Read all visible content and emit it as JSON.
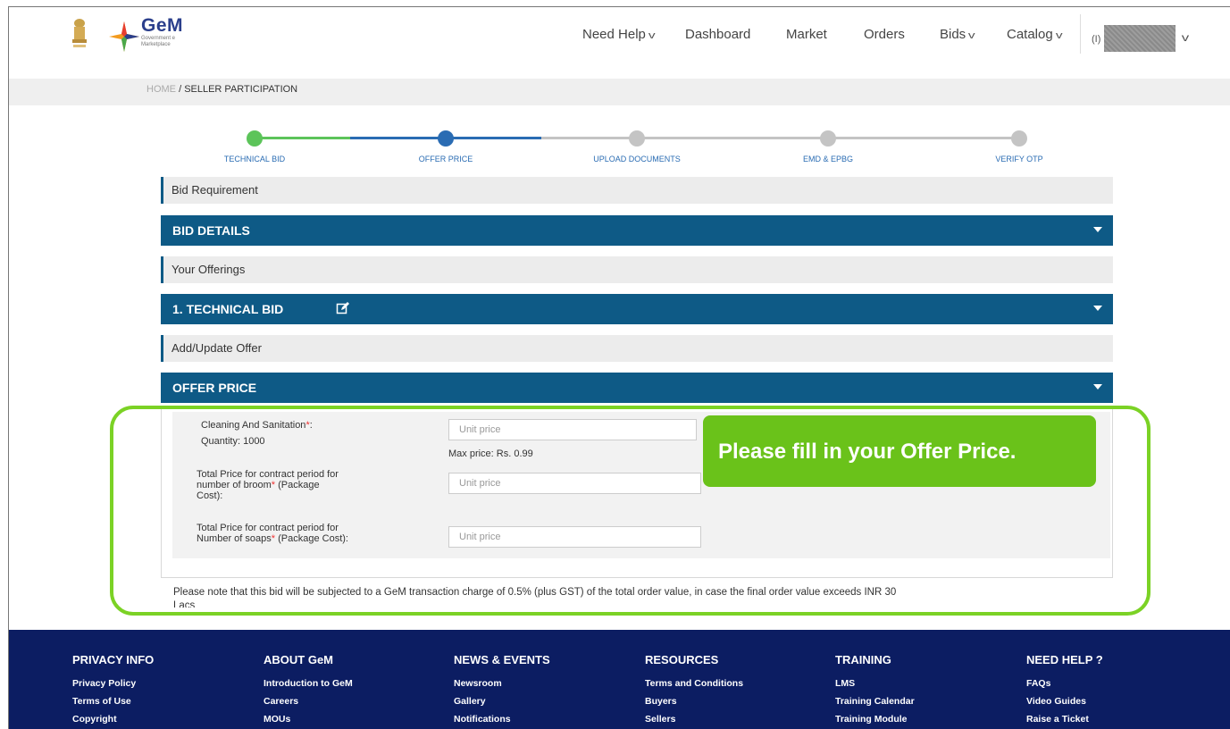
{
  "header": {
    "brand_name": "GeM",
    "brand_sub": "Government e Marketplace",
    "nav": [
      {
        "label": "Need Help",
        "dropdown": true
      },
      {
        "label": "Dashboard",
        "dropdown": false
      },
      {
        "label": "Market",
        "dropdown": false
      },
      {
        "label": "Orders",
        "dropdown": false
      },
      {
        "label": "Bids",
        "dropdown": true
      },
      {
        "label": "Catalog",
        "dropdown": true
      }
    ],
    "user_initial": "(I)"
  },
  "breadcrumb": {
    "home": "HOME",
    "separator": "/",
    "current": "SELLER PARTICIPATION"
  },
  "stepper": {
    "steps": [
      "TECHNICAL BID",
      "OFFER PRICE",
      "UPLOAD DOCUMENTS",
      "EMD & EPBG",
      "VERIFY OTP"
    ],
    "completed_color": "#5cc45a",
    "active_color": "#2a6cb3",
    "pending_color": "#c4c4c4"
  },
  "sections": {
    "bid_requirement": "Bid Requirement",
    "bid_details": "BID DETAILS",
    "your_offerings": "Your Offerings",
    "technical_bid": "1. TECHNICAL BID",
    "add_update_offer": "Add/Update Offer",
    "offer_price": "OFFER PRICE"
  },
  "offer_form": {
    "item1_label": "Cleaning And Sanitation",
    "item1_required": "*",
    "item1_colon": ":",
    "item1_quantity": "Quantity: 1000",
    "item1_placeholder": "Unit price",
    "item1_max_price": "Max price: Rs. 0.99",
    "item2_label_a": "Total Price for contract period for",
    "item2_label_b": "number of broom",
    "item2_required": "*",
    "item2_label_c": " (Package",
    "item2_label_d": "Cost):",
    "item2_placeholder": "Unit price",
    "item3_label_a": "Total Price for contract period for",
    "item3_label_b": "Number of soaps",
    "item3_required": "*",
    "item3_label_c": " (Package Cost):",
    "item3_placeholder": "Unit price"
  },
  "callout": "Please fill in your Offer Price.",
  "note_line1": "Please note that this bid will be subjected to a GeM transaction charge of 0.5% (plus GST) of the total order value, in case the final order value exceeds INR 30",
  "note_line2": "Lacs",
  "footer": {
    "columns": [
      {
        "heading": "PRIVACY INFO",
        "links": [
          "Privacy Policy",
          "Terms of Use",
          "Copyright"
        ]
      },
      {
        "heading": "ABOUT GeM",
        "links": [
          "Introduction to GeM",
          "Careers",
          "MOUs"
        ]
      },
      {
        "heading": "NEWS & EVENTS",
        "links": [
          "Newsroom",
          "Gallery",
          "Notifications"
        ]
      },
      {
        "heading": "RESOURCES",
        "links": [
          "Terms and Conditions",
          "Buyers",
          "Sellers"
        ]
      },
      {
        "heading": "TRAINING",
        "links": [
          "LMS",
          "Training Calendar",
          "Training Module"
        ]
      },
      {
        "heading": "NEED HELP ?",
        "links": [
          "FAQs",
          "Video Guides",
          "Raise a Ticket"
        ]
      }
    ]
  }
}
